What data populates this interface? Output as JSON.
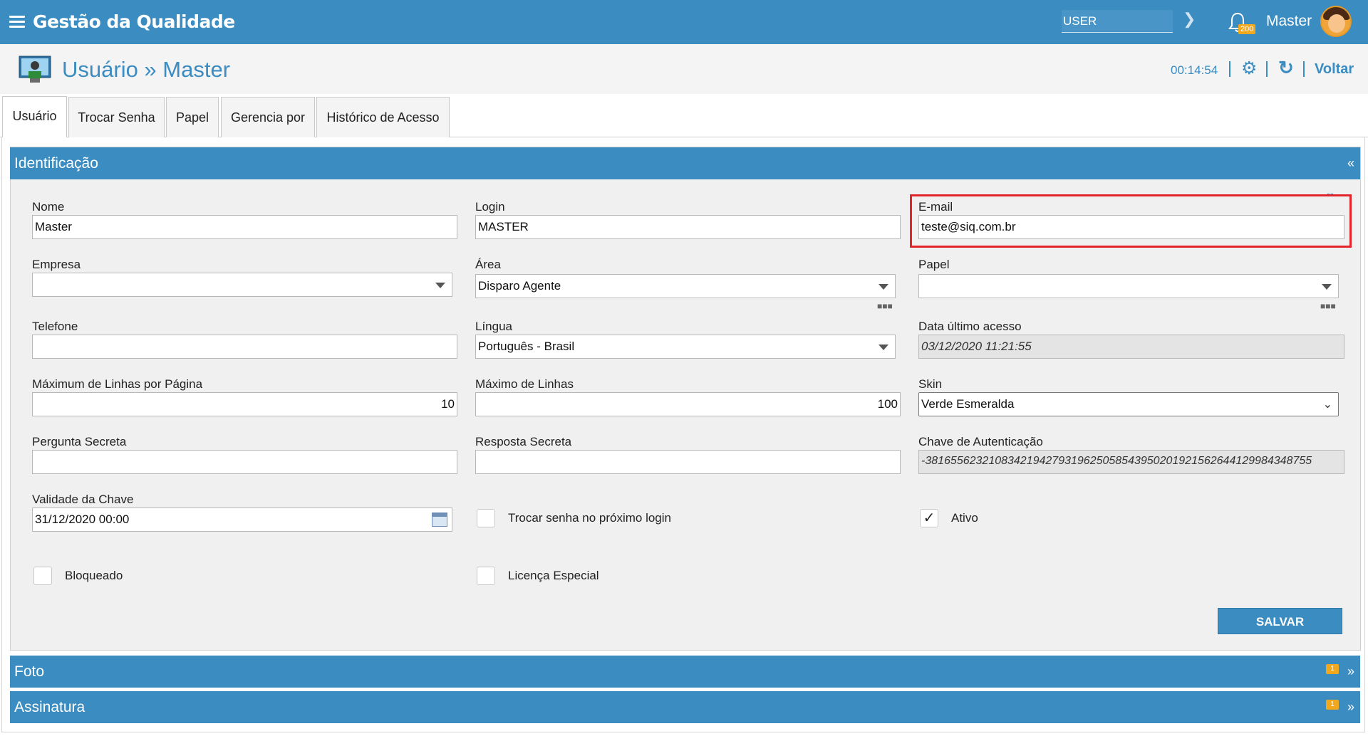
{
  "app": {
    "title": "Gestão da Qualidade",
    "user_filter": "USER",
    "notifications_count": "200",
    "user_name": "Master"
  },
  "header": {
    "title": "Usuário » Master",
    "timer": "00:14:54",
    "back_label": "Voltar"
  },
  "tabs": [
    {
      "label": "Usuário",
      "active": true
    },
    {
      "label": "Trocar Senha"
    },
    {
      "label": "Papel"
    },
    {
      "label": "Gerencia por"
    },
    {
      "label": "Histórico de Acesso"
    }
  ],
  "sections": {
    "identificacao": "Identificação",
    "foto": "Foto",
    "assinatura": "Assinatura",
    "collapse_glyph": "«",
    "expand_glyph": "»",
    "foto_badge": "1",
    "assinatura_badge": "1"
  },
  "form": {
    "nome": {
      "label": "Nome",
      "value": "Master"
    },
    "login": {
      "label": "Login",
      "value": "MASTER"
    },
    "email": {
      "label": "E-mail",
      "value": "teste@siq.com.br"
    },
    "empresa": {
      "label": "Empresa",
      "value": ""
    },
    "area": {
      "label": "Área",
      "value": "Disparo Agente"
    },
    "papel": {
      "label": "Papel",
      "value": ""
    },
    "telefone": {
      "label": "Telefone",
      "value": ""
    },
    "lingua": {
      "label": "Língua",
      "value": "Português - Brasil"
    },
    "data_ultimo_acesso": {
      "label": "Data último acesso",
      "value": "03/12/2020 11:21:55"
    },
    "max_linhas_pagina": {
      "label": "Máximum de Linhas por Página",
      "value": "10"
    },
    "max_linhas": {
      "label": "Máximo de Linhas",
      "value": "100"
    },
    "skin": {
      "label": "Skin",
      "value": "Verde Esmeralda"
    },
    "pergunta_secreta": {
      "label": "Pergunta Secreta",
      "value": ""
    },
    "resposta_secreta": {
      "label": "Resposta Secreta",
      "value": ""
    },
    "chave_autenticacao": {
      "label": "Chave de Autenticação",
      "value": "-3816556232108342194279319625058543950201921562644129984348755"
    },
    "validade_chave": {
      "label": "Validade da Chave",
      "value": "31/12/2020 00:00"
    },
    "trocar_senha": {
      "label": "Trocar senha no próximo login",
      "checked": false
    },
    "ativo": {
      "label": "Ativo",
      "checked": true
    },
    "bloqueado": {
      "label": "Bloqueado",
      "checked": false
    },
    "licenca_especial": {
      "label": "Licença Especial",
      "checked": false
    },
    "save_label": "SALVAR"
  },
  "colors": {
    "primary": "#3a8cc1",
    "badge": "#f2a81d",
    "highlight": "#e3242b"
  }
}
